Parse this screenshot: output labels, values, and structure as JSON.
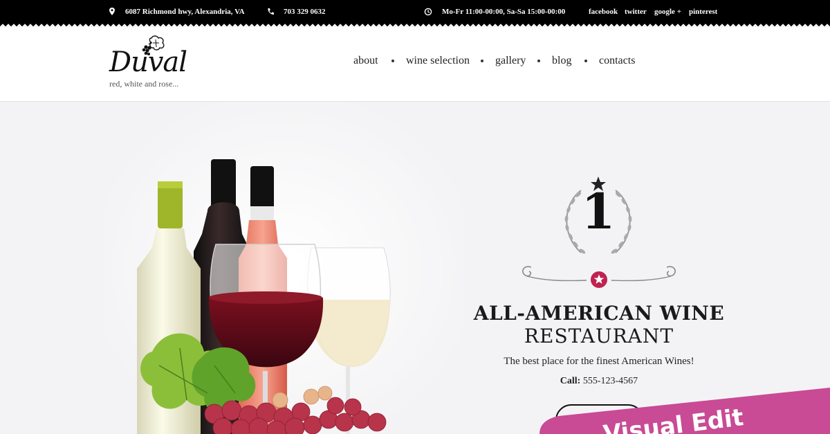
{
  "topbar": {
    "address": "6087 Richmond hwy, Alexandria, VA",
    "phone": "703 329 0632",
    "hours": "Mo-Fr 11:00-00:00, Sa-Sa 15:00-00:00",
    "social": [
      "facebook",
      "twitter",
      "google +",
      "pinterest"
    ],
    "icons": {
      "address": "map-pin-icon",
      "phone": "phone-icon",
      "hours": "clock-icon"
    }
  },
  "brand": {
    "name": "Duval",
    "tagline": "red, white and rose..."
  },
  "nav": {
    "items": [
      "about",
      "wine selection",
      "gallery",
      "blog",
      "contacts"
    ]
  },
  "hero": {
    "badge_number": "1",
    "title_line1": "ALL-AMERICAN WINE",
    "title_line2": "RESTAURANT",
    "subtitle": "The best place for the finest American Wines!",
    "call_label": "Call:",
    "call_number": "555-123-4567",
    "button_label": ""
  },
  "promo": {
    "text": "Visual Edit",
    "color": "#c94a95"
  },
  "colors": {
    "accent": "#c0224f",
    "topbar_bg": "#000000",
    "hero_bg": "#f3f3f5"
  }
}
